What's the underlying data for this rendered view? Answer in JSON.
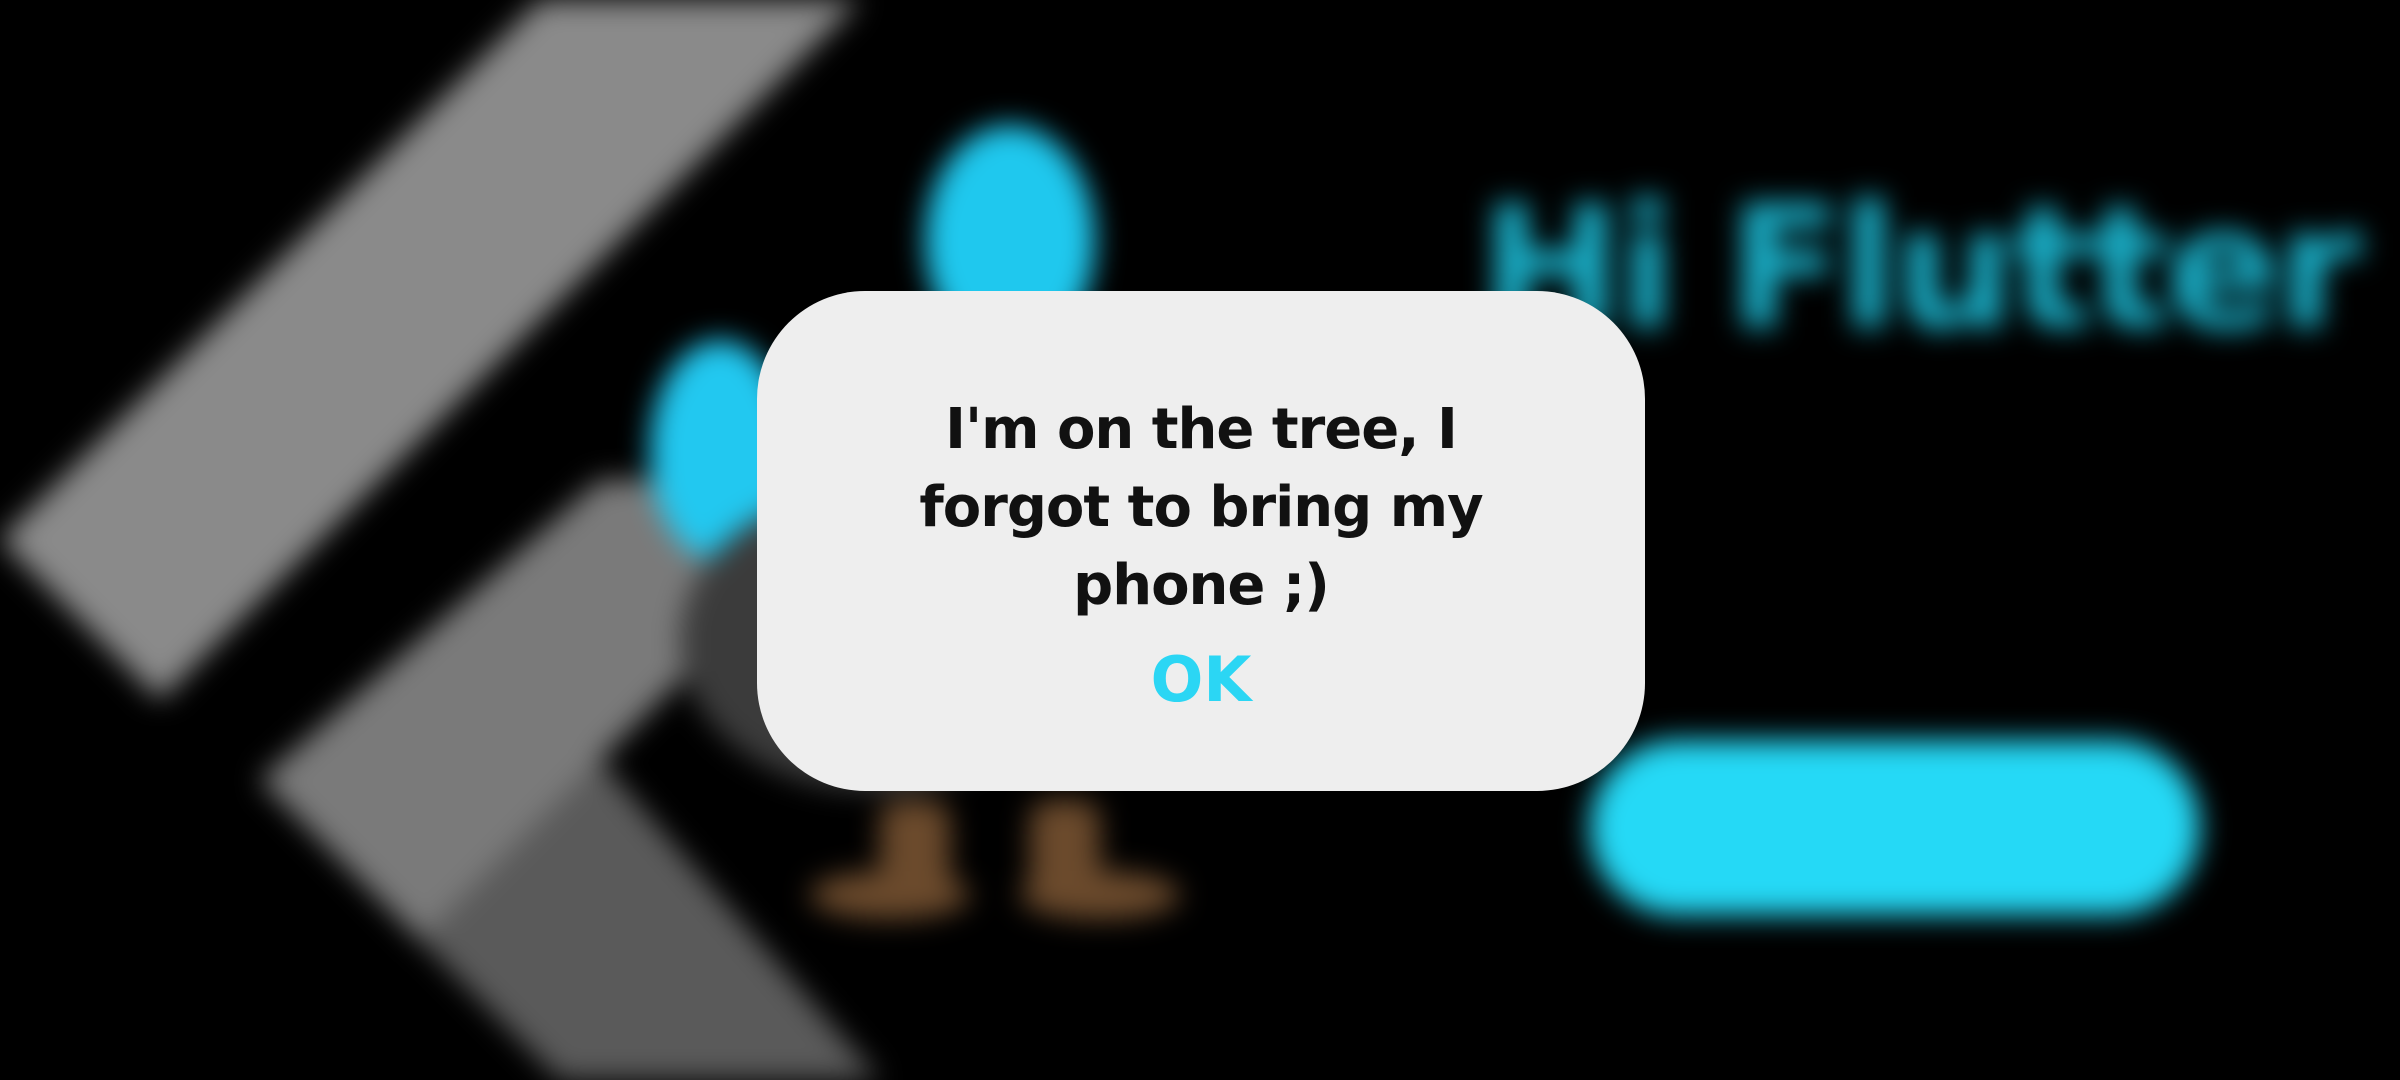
{
  "background": {
    "title": "Hi Flutter",
    "subtitle": "",
    "button_label": "",
    "accent_color": "#25d9f6",
    "logo": "flutter-logo-icon",
    "mascot": "dash-bird-mascot"
  },
  "dialog": {
    "message": "I'm on the tree, I forgot to bring my phone ;)",
    "ok_label": "OK",
    "ok_color": "#2bd6f4",
    "background_color": "#eeeeee"
  }
}
